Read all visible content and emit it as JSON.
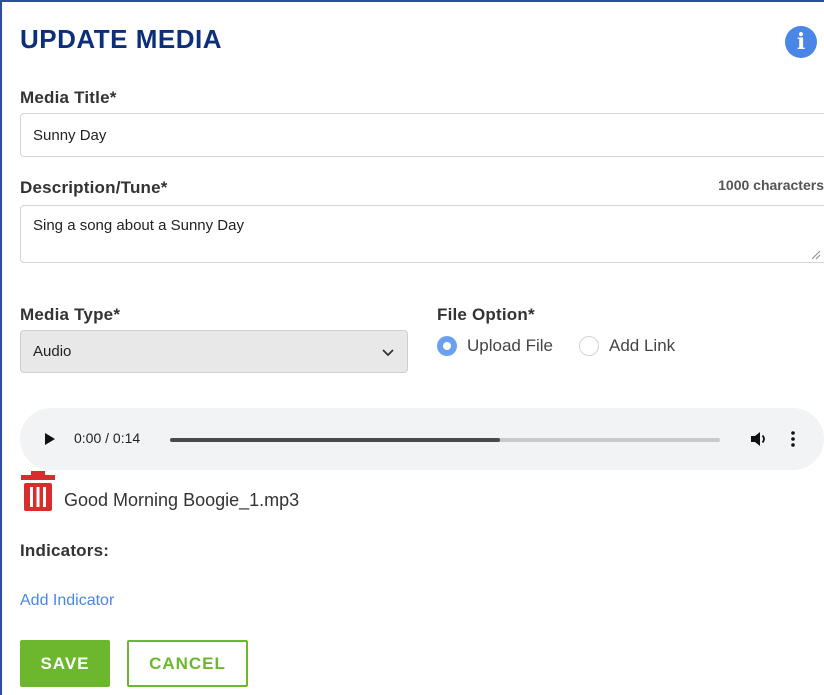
{
  "header": {
    "title": "UPDATE MEDIA",
    "info_icon": "info-icon"
  },
  "form": {
    "media_title": {
      "label": "Media Title*",
      "value": "Sunny Day"
    },
    "description": {
      "label": "Description/Tune*",
      "counter": "1000 characters",
      "value": "Sing a song about a Sunny Day"
    },
    "media_type": {
      "label": "Media Type*",
      "selected": "Audio"
    },
    "file_option": {
      "label": "File Option*",
      "options": [
        {
          "label": "Upload File",
          "selected": true
        },
        {
          "label": "Add Link",
          "selected": false
        }
      ]
    }
  },
  "player": {
    "time": "0:00 / 0:14",
    "progress": 0.6
  },
  "file": {
    "name": "Good Morning Boogie_1.mp3"
  },
  "indicators": {
    "label": "Indicators:",
    "add_link": "Add Indicator"
  },
  "buttons": {
    "save": "SAVE",
    "cancel": "CANCEL"
  },
  "colors": {
    "title": "#0d2f7a",
    "accent": "#4a86e8",
    "green": "#6cb72e",
    "delete": "#d92d2d"
  }
}
